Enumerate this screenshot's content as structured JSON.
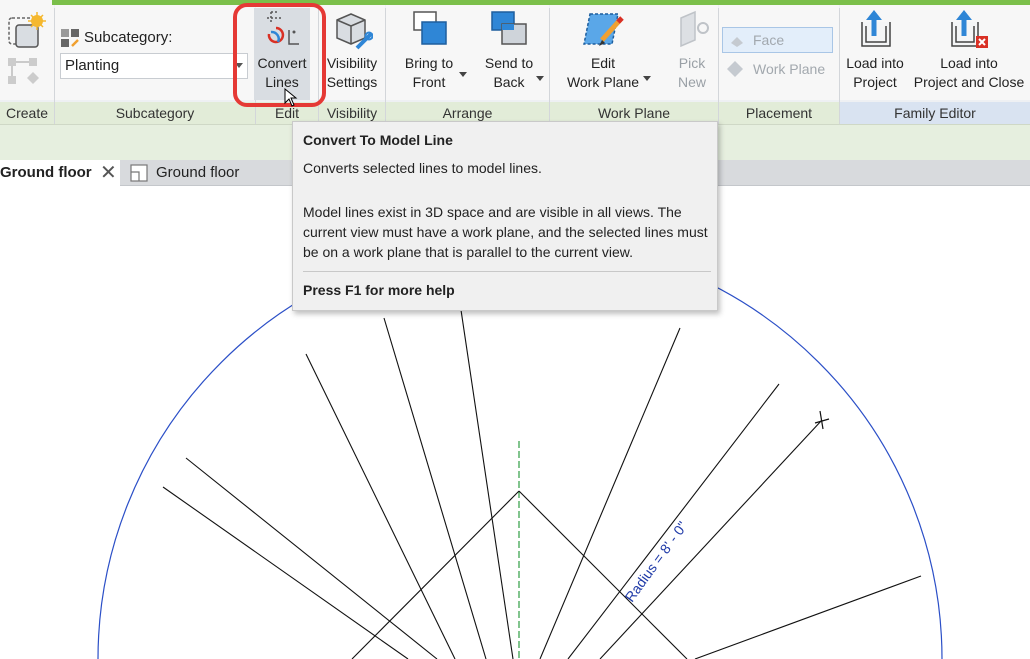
{
  "ribbon": {
    "panels": {
      "create": "Create",
      "subcategory": "Subcategory",
      "edit": "Edit",
      "visibility": "Visibility",
      "arrange": "Arrange",
      "work_plane": "Work Plane",
      "placement": "Placement",
      "family_editor": "Family Editor"
    },
    "subcategory": {
      "title": "Subcategory:",
      "selected": "Planting"
    },
    "tools": {
      "convert_lines": [
        "Convert",
        "Lines"
      ],
      "visibility_settings": [
        "Visibility",
        "Settings"
      ],
      "bring_to_front": [
        "Bring to",
        "Front"
      ],
      "send_to_back": [
        "Send to",
        "Back"
      ],
      "edit_work_plane": [
        "Edit",
        "Work Plane"
      ],
      "pick_new": [
        "Pick",
        "New"
      ],
      "face": "Face",
      "work_plane": "Work Plane",
      "load_into_project": [
        "Load into",
        "Project"
      ],
      "load_into_project_close": [
        "Load into",
        "Project and Close"
      ]
    },
    "colors": {
      "accent_green": "#7bbf4a",
      "highlight_red": "#e53935",
      "icon_blue": "#2f86d6"
    }
  },
  "tabs": [
    {
      "label": "Ground floor",
      "active": true
    },
    {
      "label": "Ground floor",
      "active": false
    }
  ],
  "tooltip": {
    "title": "Convert To Model Line",
    "subtitle": "Converts selected lines to model lines.",
    "body": "Model lines exist in 3D space and are visible in all views. The current view must have a work plane, and the selected lines must be on a work plane that is parallel to the current view.",
    "help": "Press F1 for more help"
  },
  "drawing": {
    "dimension_label": "Radius = 8' - 0\""
  }
}
